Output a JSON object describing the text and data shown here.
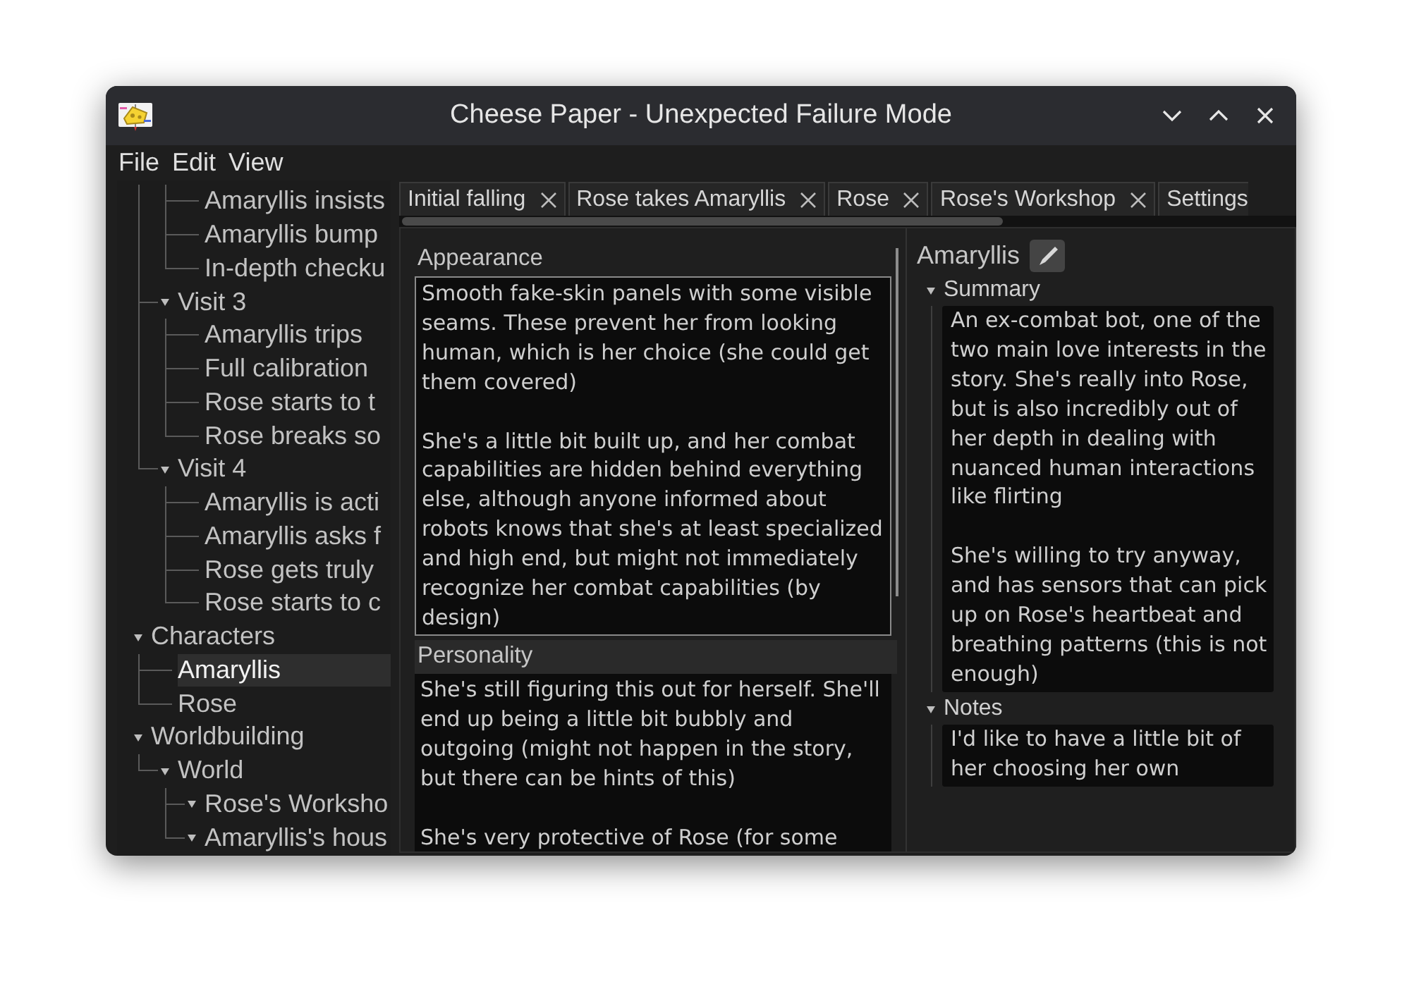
{
  "window": {
    "title": "Cheese Paper - Unexpected Failure Mode"
  },
  "menu": [
    "File",
    "Edit",
    "View"
  ],
  "outline": [
    {
      "expanded": true,
      "children": [
        {
          "expanded": true,
          "children": [
            {
              "label": "Amaryllis insists",
              "selected": false
            },
            {
              "label": "Amaryllis bump",
              "selected": false
            },
            {
              "label": "In-depth checku",
              "selected": false
            }
          ]
        },
        {
          "label": "Visit 3",
          "expanded": true,
          "selected": false,
          "children": [
            {
              "label": "Amaryllis trips",
              "selected": false
            },
            {
              "label": "Full calibration",
              "selected": false
            },
            {
              "label": "Rose starts to t",
              "selected": false
            },
            {
              "label": "Rose breaks so",
              "selected": false
            }
          ]
        },
        {
          "label": "Visit 4",
          "expanded": true,
          "selected": false,
          "children": [
            {
              "label": "Amaryllis is acti",
              "selected": false
            },
            {
              "label": "Amaryllis asks f",
              "selected": false
            },
            {
              "label": "Rose gets truly",
              "selected": false
            },
            {
              "label": "Rose starts to c",
              "selected": false
            }
          ]
        }
      ]
    },
    {
      "label": "Characters",
      "expanded": true,
      "selected": false,
      "children": [
        {
          "label": "Amaryllis",
          "selected": true
        },
        {
          "label": "Rose",
          "selected": false
        }
      ]
    },
    {
      "label": "Worldbuilding",
      "expanded": true,
      "selected": false,
      "children": [
        {
          "label": "World",
          "expanded": true,
          "selected": false,
          "children": [
            {
              "label": "Rose's Worksho",
              "expanded": true,
              "selected": false
            },
            {
              "label": "Amaryllis's hous",
              "expanded": true,
              "selected": false
            }
          ]
        }
      ]
    }
  ],
  "tabs": [
    {
      "label": "Initial falling"
    },
    {
      "label": "Rose takes Amaryllis"
    },
    {
      "label": "Rose"
    },
    {
      "label": "Rose's Workshop"
    },
    {
      "label": "Settings"
    }
  ],
  "fields": [
    {
      "label": "Appearance",
      "focused": true,
      "text": "Smooth fake-skin panels with some visible seams. These prevent her from looking human, which is her choice (she could get them covered)\n\nShe's a little bit built up, and her combat capabilities are hidden behind everything else, although anyone informed about robots knows that she's at least specialized and high end, but might not immediately recognize her combat capabilities (by design)"
    },
    {
      "label": "Personality",
      "focused": false,
      "text": "She's still figuring this out for herself. She'll end up being a little bit bubbly and outgoing (might not happen in the story, but there can be hints of this)\n\nShe's very protective of Rose (for some"
    }
  ],
  "detail": {
    "name": "Amaryllis",
    "sections": [
      {
        "label": "Summary",
        "expanded": true,
        "text": "An ex-combat bot, one of the two main love interests in the story. She's really into Rose, but is also incredibly out of her depth in dealing with nuanced human interactions like flirting\n\nShe's willing to try anyway, and has sensors that can pick up on Rose's heartbeat and breathing patterns (this is not enough)"
      },
      {
        "label": "Notes",
        "expanded": true,
        "text": "I'd like to have a little bit of her choosing her own"
      }
    ]
  }
}
